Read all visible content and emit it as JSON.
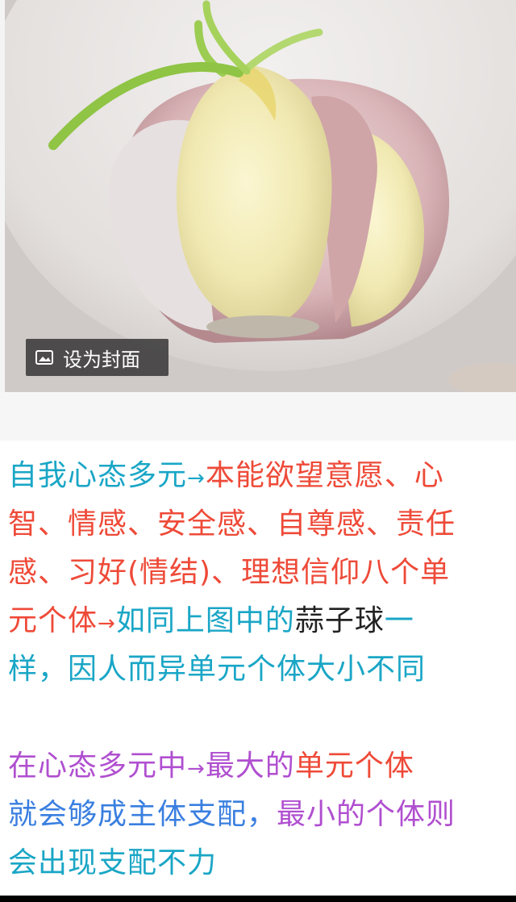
{
  "photo": {
    "cover_button_label": "设为封面",
    "icon": "image-icon"
  },
  "text": {
    "p1": {
      "l1": {
        "a": "自我心态多元",
        "arrow": "→",
        "b": "本能欲望意愿、心"
      },
      "l2": "智、情感、安全感、自尊感、责任",
      "l3": "感、习好(情结)、理想信仰八个单",
      "l4": {
        "a": "元个体",
        "arrow": "→",
        "b": "如同上图中的",
        "c": "蒜子球",
        "d": "一"
      },
      "l5": "样，因人而异单元个体大小不同"
    },
    "p2": {
      "l1": {
        "a": "在心态多元中",
        "arrow": "→",
        "b": "最大的",
        "c": "单元个体"
      },
      "l2": {
        "a": "就会够成主体支配，",
        "b": "最小的个体则"
      },
      "l3": "会出现支配不力"
    }
  },
  "colors": {
    "teal": "#1aa6c6",
    "red": "#ee4a38",
    "dark": "#222222",
    "purple": "#b04fd0",
    "blue": "#3a7fe0"
  }
}
